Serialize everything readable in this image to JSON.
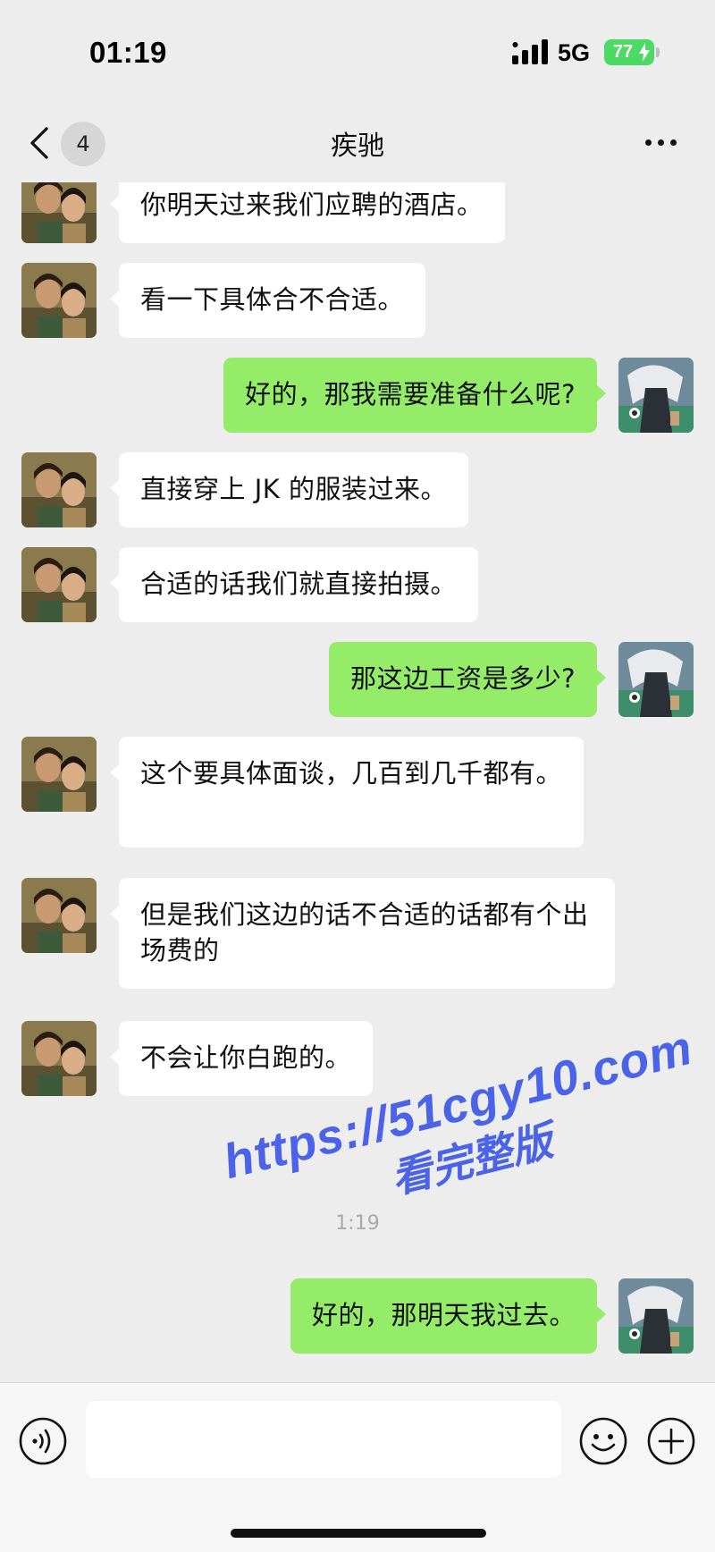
{
  "status_bar": {
    "time": "01:19",
    "network": "5G",
    "battery": "77",
    "battery_level_percent": 77
  },
  "nav": {
    "unread_count": "4",
    "title": "疾驰"
  },
  "colors": {
    "background": "#ededed",
    "incoming_bubble": "#ffffff",
    "outgoing_bubble": "#95ec69",
    "battery": "#4cd964",
    "watermark": "#4b63e8"
  },
  "messages": [
    {
      "side": "in",
      "text": "你明天过来我们应聘的酒店。"
    },
    {
      "side": "in",
      "text": "看一下具体合不合适。"
    },
    {
      "side": "out",
      "text": "好的，那我需要准备什么呢?"
    },
    {
      "side": "in",
      "text": "直接穿上 JK 的服装过来。"
    },
    {
      "side": "in",
      "text": "合适的话我们就直接拍摄。"
    },
    {
      "side": "out",
      "text": "那这边工资是多少?"
    },
    {
      "side": "in",
      "text": "这个要具体面谈，几百到几千都有。"
    },
    {
      "side": "in",
      "text": "但是我们这边的话不合适的话都有个出场费的"
    },
    {
      "side": "in",
      "text": "不会让你白跑的。"
    },
    {
      "side": "out",
      "text": "好的，那明天我过去。"
    }
  ],
  "time_divider": "1:19",
  "watermark": {
    "url": "https://51cgy10.com",
    "subtitle": "看完整版"
  },
  "input_bar": {
    "placeholder": "",
    "icons": [
      "voice-icon",
      "emoji-icon",
      "plus-icon"
    ]
  }
}
